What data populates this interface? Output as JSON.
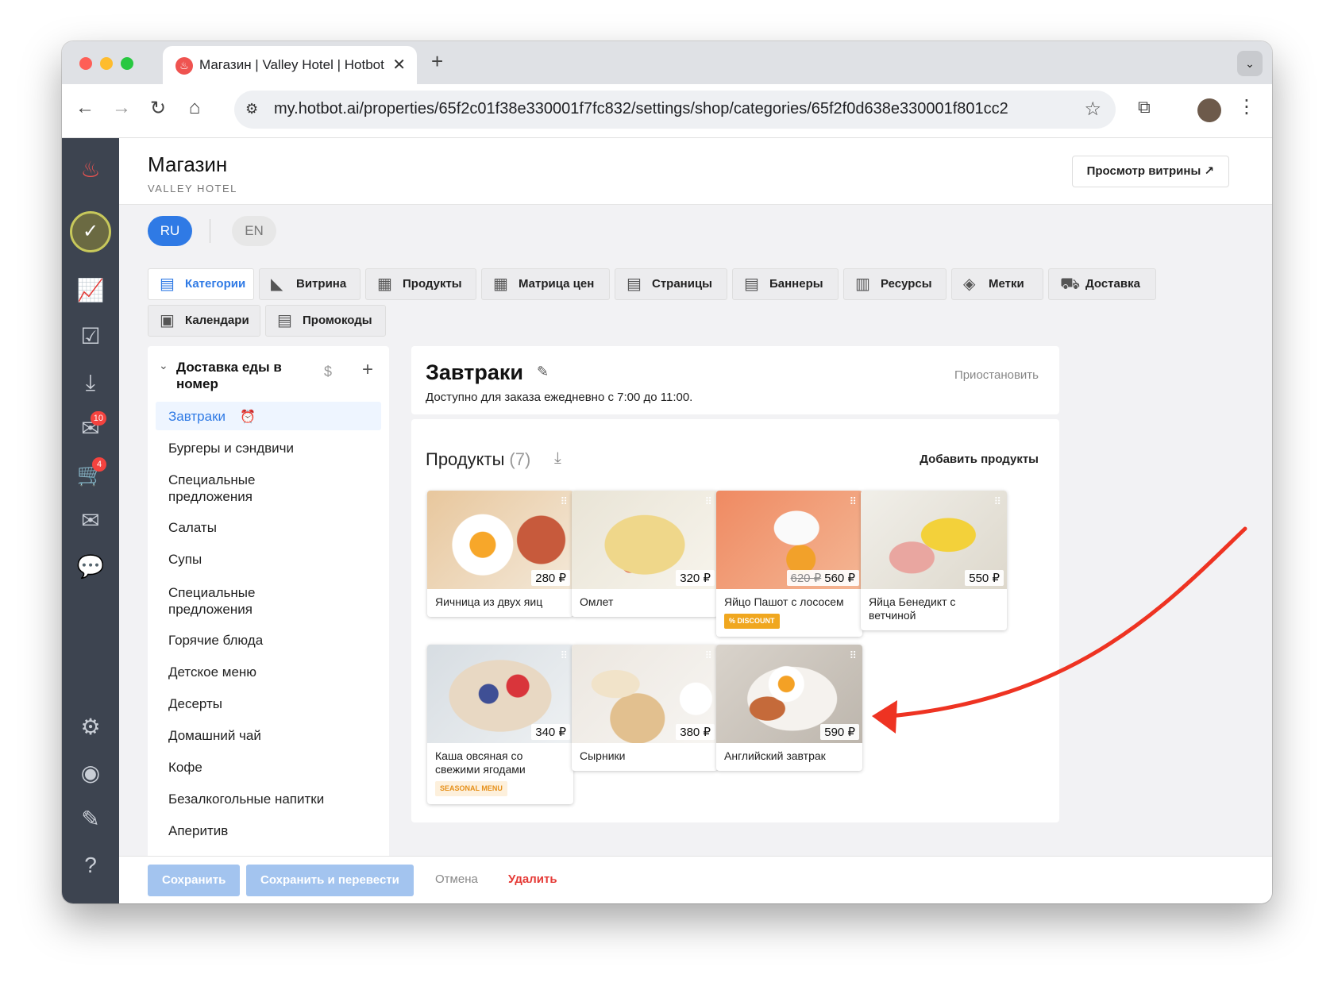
{
  "browser": {
    "tab_title": "Магазин | Valley Hotel | Hotbot",
    "url": "my.hotbot.ai/properties/65f2c01f38e330001f7fc832/settings/shop/categories/65f2f0d638e330001f801cc2"
  },
  "sidebar": {
    "badges": {
      "inbox": "10",
      "cart": "4"
    }
  },
  "header": {
    "title": "Магазин",
    "subtitle": "VALLEY HOTEL",
    "view_button": "Просмотр витрины ↗"
  },
  "lang": {
    "ru": "RU",
    "en": "EN"
  },
  "tabs": [
    {
      "label": "Категории"
    },
    {
      "label": "Витрина"
    },
    {
      "label": "Продукты"
    },
    {
      "label": "Матрица цен"
    },
    {
      "label": "Страницы"
    },
    {
      "label": "Баннеры"
    },
    {
      "label": "Ресурсы"
    },
    {
      "label": "Метки"
    },
    {
      "label": "Доставка"
    },
    {
      "label": "Календари"
    },
    {
      "label": "Промокоды"
    }
  ],
  "categories": {
    "group": "Доставка еды в номер",
    "items": [
      "Завтраки",
      "Бургеры и сэндвичи",
      "Специальные предложения",
      "Салаты",
      "Супы",
      "Специальные предложения",
      "Горячие блюда",
      "Детское меню",
      "Десерты",
      "Домашний чай",
      "Кофе",
      "Безалкогольные напитки",
      "Аперитив"
    ]
  },
  "category": {
    "title": "Завтраки",
    "description": "Доступно для заказа ежедневно с 7:00 до 11:00.",
    "pause": "Приостановить"
  },
  "products": {
    "title": "Продукты",
    "count": "(7)",
    "add": "Добавить продукты",
    "items": [
      {
        "name": "Яичница из двух яиц",
        "price": "280 ₽",
        "old_price": "",
        "tag": ""
      },
      {
        "name": "Омлет",
        "price": "320 ₽",
        "old_price": "",
        "tag": ""
      },
      {
        "name": "Яйцо Пашот с лососем",
        "price": "560 ₽",
        "old_price": "620 ₽",
        "tag": "% DISCOUNT"
      },
      {
        "name": "Яйца Бенедикт с ветчиной",
        "price": "550 ₽",
        "old_price": "",
        "tag": ""
      },
      {
        "name": "Каша овсяная со свежими ягодами",
        "price": "340 ₽",
        "old_price": "",
        "tag": "SEASONAL MENU"
      },
      {
        "name": "Сырники",
        "price": "380 ₽",
        "old_price": "",
        "tag": ""
      },
      {
        "name": "Английский завтрак",
        "price": "590 ₽",
        "old_price": "",
        "tag": ""
      }
    ]
  },
  "footer": {
    "save": "Сохранить",
    "save_translate": "Сохранить и перевести",
    "cancel": "Отмена",
    "delete": "Удалить"
  },
  "colors": {
    "accent": "#2f7ae5",
    "sidebar": "#3d4450",
    "danger": "#e53935",
    "arrow": "#ee3322"
  }
}
